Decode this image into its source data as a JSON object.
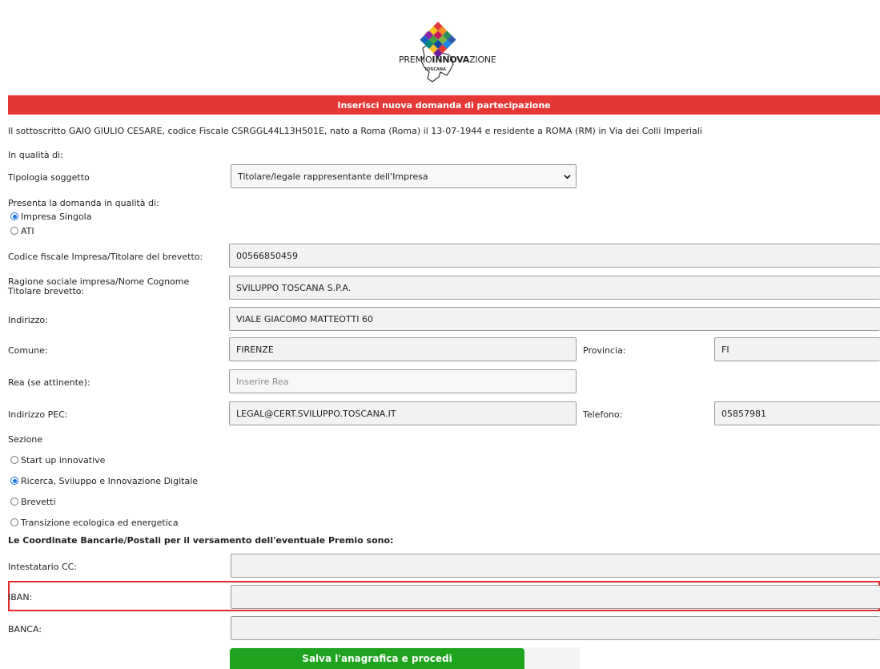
{
  "logo": {
    "text_prefix": "PREMIO",
    "text_bold": "INNOVA",
    "text_suffix": "ZIONE",
    "sub": "TOSCANA"
  },
  "header": {
    "title": "Inserisci nuova domanda di partecipazione"
  },
  "intro": "Il sottoscritto GAIO GIULIO CESARE, codice Fiscale CSRGGL44L13H501E, nato a Roma (Roma) il 13-07-1944 e residente a ROMA (RM) in Via dei Colli Imperiali",
  "in_qualita": "In qualità di:",
  "tipologia": {
    "label": "Tipologia soggetto",
    "value": "Titolare/legale rappresentante dell'Impresa"
  },
  "presenta": {
    "label": "Presenta la domanda in qualità di:",
    "options": [
      "Impresa Singola",
      "ATI"
    ],
    "selected": "Impresa Singola"
  },
  "fields": {
    "codice_fiscale": {
      "label": "Codice fiscale Impresa/Titolare del brevetto:",
      "value": "00566850459"
    },
    "ragione_sociale": {
      "label": "Ragione sociale impresa/Nome Cognome Titolare brevetto:",
      "value": "SVILUPPO TOSCANA S.P.A."
    },
    "indirizzo": {
      "label": "Indirizzo:",
      "value": "VIALE GIACOMO MATTEOTTI 60"
    },
    "comune": {
      "label": "Comune:",
      "value": "FIRENZE"
    },
    "provincia": {
      "label": "Provincia:",
      "value": "FI"
    },
    "rea": {
      "label": "Rea (se attinente):",
      "placeholder": "Inserire Rea"
    },
    "pec": {
      "label": "Indirizzo PEC:",
      "value": "LEGAL@CERT.SVILUPPO.TOSCANA.IT"
    },
    "telefono": {
      "label": "Telefono:",
      "value": "05857981"
    }
  },
  "sezione": {
    "label": "Sezione",
    "options": [
      "Start up innovative",
      "Ricerca, Sviluppo e Innovazione Digitale",
      "Brevetti",
      "Transizione ecologica ed energetica"
    ],
    "selected": "Ricerca, Sviluppo e Innovazione Digitale"
  },
  "coordinate": {
    "heading": "Le Coordinate Bancarie/Postali per il versamento dell'eventuale Premio sono:",
    "intestatario_label": "Intestatario CC:",
    "intestatario_value": "",
    "iban_label": "IBAN:",
    "iban_value": "",
    "banca_label": "BANCA:",
    "banca_value": ""
  },
  "actions": {
    "save_label": "Salva l'anagrafica e procedi"
  },
  "colors": {
    "header_bg": "#e53836",
    "save_bg": "#1ea31e",
    "highlight": "#e02b2b",
    "radio_accent": "#1a73e8"
  }
}
